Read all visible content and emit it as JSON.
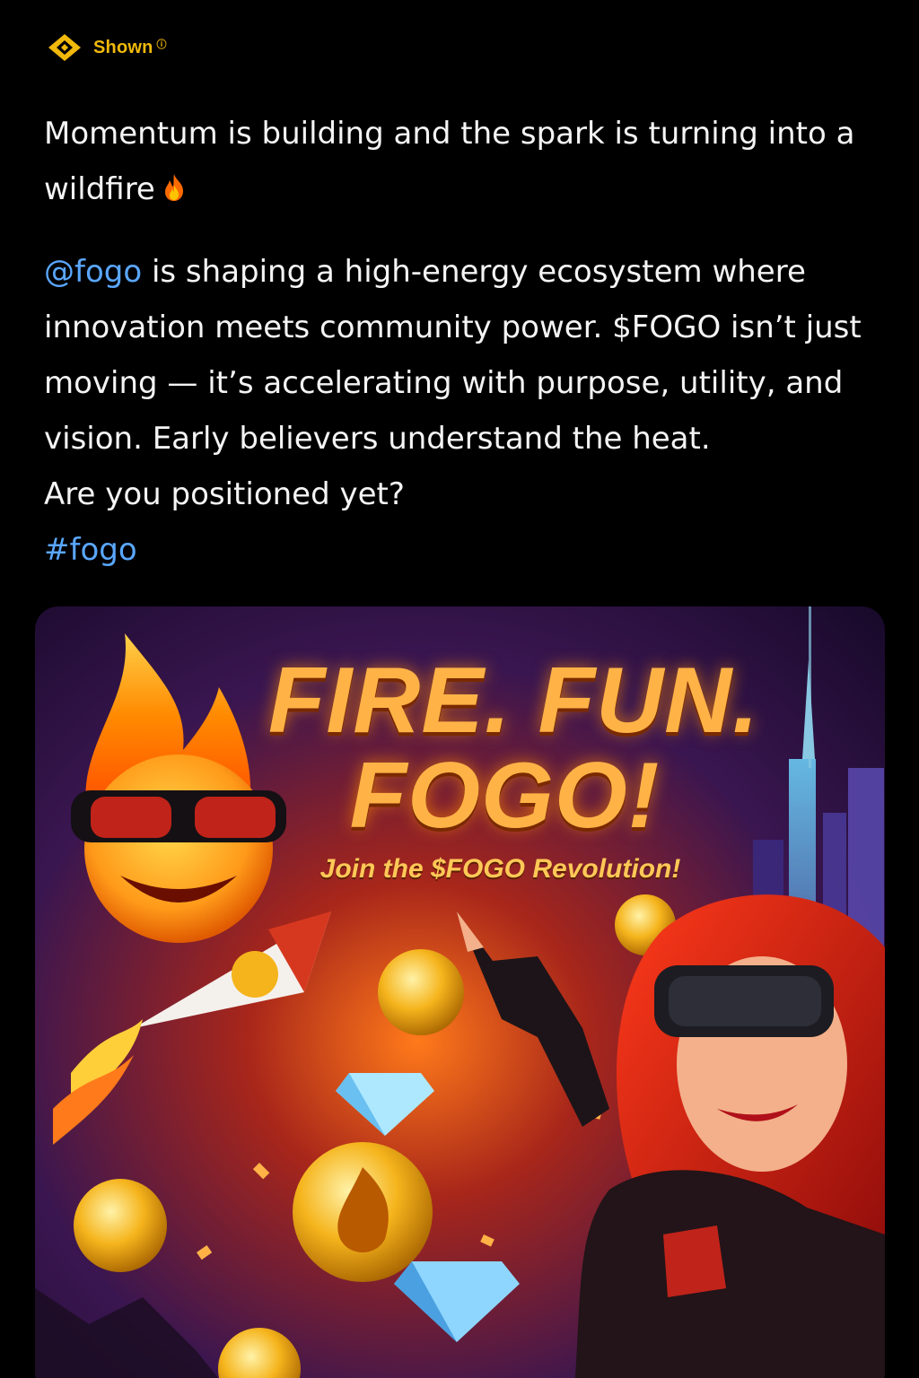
{
  "header": {
    "source_label": "Shown",
    "source_badge": "ⓘ",
    "brand_color": "#F0B90B",
    "icon": "binance-diamond-icon"
  },
  "post": {
    "para1_text": "Momentum is building and the spark is turning into a wildfire",
    "para1_emoji": "fire-emoji",
    "mention": "@fogo",
    "para2_text": " is shaping a high-energy ecosystem where innovation meets community power. $FOGO isn’t just moving — it’s accelerating with purpose, utility, and vision. Early believers understand the heat.",
    "para2_question": "Are you positioned yet?",
    "hashtag": "#fogo",
    "link_color": "#5aa7ff"
  },
  "media": {
    "title_line1": "FIRE. FUN.",
    "title_line2": "FOGO!",
    "subtitle": "Join the $FOGO Revolution!"
  }
}
